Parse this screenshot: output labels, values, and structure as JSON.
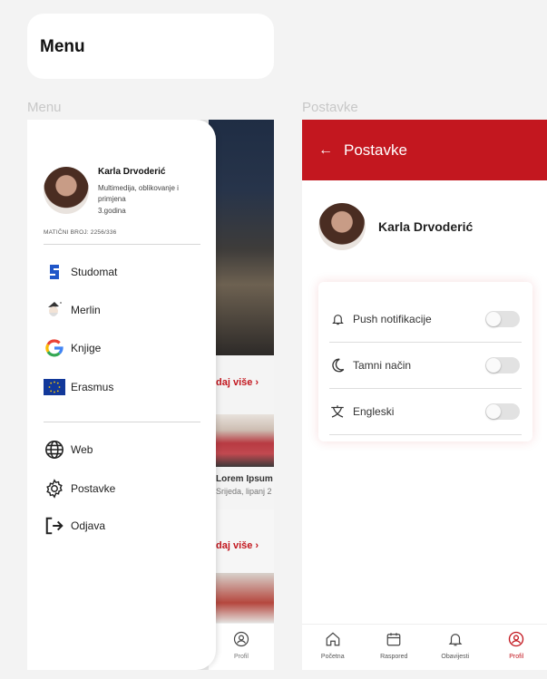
{
  "top_card": {
    "title": "Menu"
  },
  "labels": {
    "left": "Menu",
    "right": "Postavke"
  },
  "drawer": {
    "user_name": "Karla Drvoderić",
    "program": "Multimedija, oblikovanje i primjena",
    "year": "3.godina",
    "id_line": "MATIČNI BROJ: 2256/336",
    "items": [
      {
        "label": "Studomat",
        "icon": "studomat-icon"
      },
      {
        "label": "Merlin",
        "icon": "merlin-icon"
      },
      {
        "label": "Knjige",
        "icon": "google-icon"
      },
      {
        "label": "Erasmus",
        "icon": "eu-flag-icon"
      }
    ],
    "items2": [
      {
        "label": "Web",
        "icon": "globe-icon"
      },
      {
        "label": "Postavke",
        "icon": "gear-icon"
      },
      {
        "label": "Odjava",
        "icon": "logout-icon"
      }
    ]
  },
  "background": {
    "more1": "daj više ›",
    "news_title": "Lorem Ipsum",
    "news_date": "Srijeda, lipanj 2",
    "more2": "daj više ›",
    "nav_label": "Profil"
  },
  "settings": {
    "back_arrow": "←",
    "title": "Postavke",
    "user_name": "Karla Drvoderić",
    "rows": [
      {
        "label": "Push notifikacije",
        "icon": "bell-icon",
        "enabled": false
      },
      {
        "label": "Tamni način",
        "icon": "moon-icon",
        "enabled": false
      },
      {
        "label": "Engleski",
        "icon": "translate-icon",
        "enabled": false
      }
    ]
  },
  "bottom_nav": [
    {
      "label": "Početna",
      "icon": "home-icon"
    },
    {
      "label": "Raspored",
      "icon": "calendar-icon"
    },
    {
      "label": "Obavijesti",
      "icon": "bell-icon"
    },
    {
      "label": "Profil",
      "icon": "profile-icon",
      "active": true
    }
  ],
  "colors": {
    "accent": "#c3171f",
    "background": "#f3f3f3"
  }
}
